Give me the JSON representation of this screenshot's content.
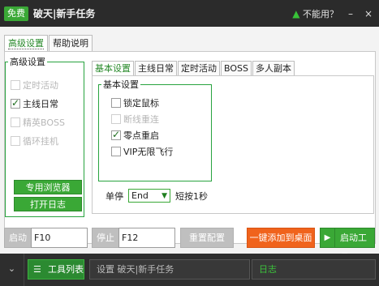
{
  "titlebar": {
    "badge": "免费",
    "title": "破天|新手任务",
    "help_text": "不能用？",
    "minimize": "–",
    "close": "×"
  },
  "top_tabs": [
    "高级设置",
    "帮助说明"
  ],
  "advanced_group": {
    "legend": "高级设置",
    "items": [
      {
        "label": "定时活动",
        "checked": false,
        "disabled": true
      },
      {
        "label": "主线日常",
        "checked": true,
        "disabled": false
      },
      {
        "label": "精英BOSS",
        "checked": false,
        "disabled": true
      },
      {
        "label": "循环挂机",
        "checked": false,
        "disabled": true
      }
    ],
    "browser_button": "专用浏览器",
    "log_button": "打开日志"
  },
  "inner_tabs": [
    "基本设置",
    "主线日常",
    "定时活动",
    "BOSS",
    "多人副本"
  ],
  "basic_group": {
    "legend": "基本设置",
    "items": [
      {
        "label": "锁定鼠标",
        "checked": false,
        "disabled": false
      },
      {
        "label": "断线重连",
        "checked": false,
        "disabled": true
      },
      {
        "label": "零点重启",
        "checked": true,
        "disabled": false
      },
      {
        "label": "VIP无限飞行",
        "checked": false,
        "disabled": false
      }
    ]
  },
  "stop_control": {
    "label": "单停",
    "select_value": "End",
    "extra": "短按1秒"
  },
  "control_bar": {
    "start_label": "启动",
    "start_hotkey": "F10",
    "stop_label": "停止",
    "stop_hotkey": "F12",
    "reset_label": "重置配置",
    "desktop_label": "一键添加到桌面",
    "launch_label": "启动工具"
  },
  "footer": {
    "tools_label": "工具列表",
    "status_text": "设置 破天|新手任务",
    "log_text": "日志"
  },
  "colors": {
    "accent_green": "#3aa836",
    "orange": "#f0631c",
    "dark_bg": "#2b2b2b"
  }
}
